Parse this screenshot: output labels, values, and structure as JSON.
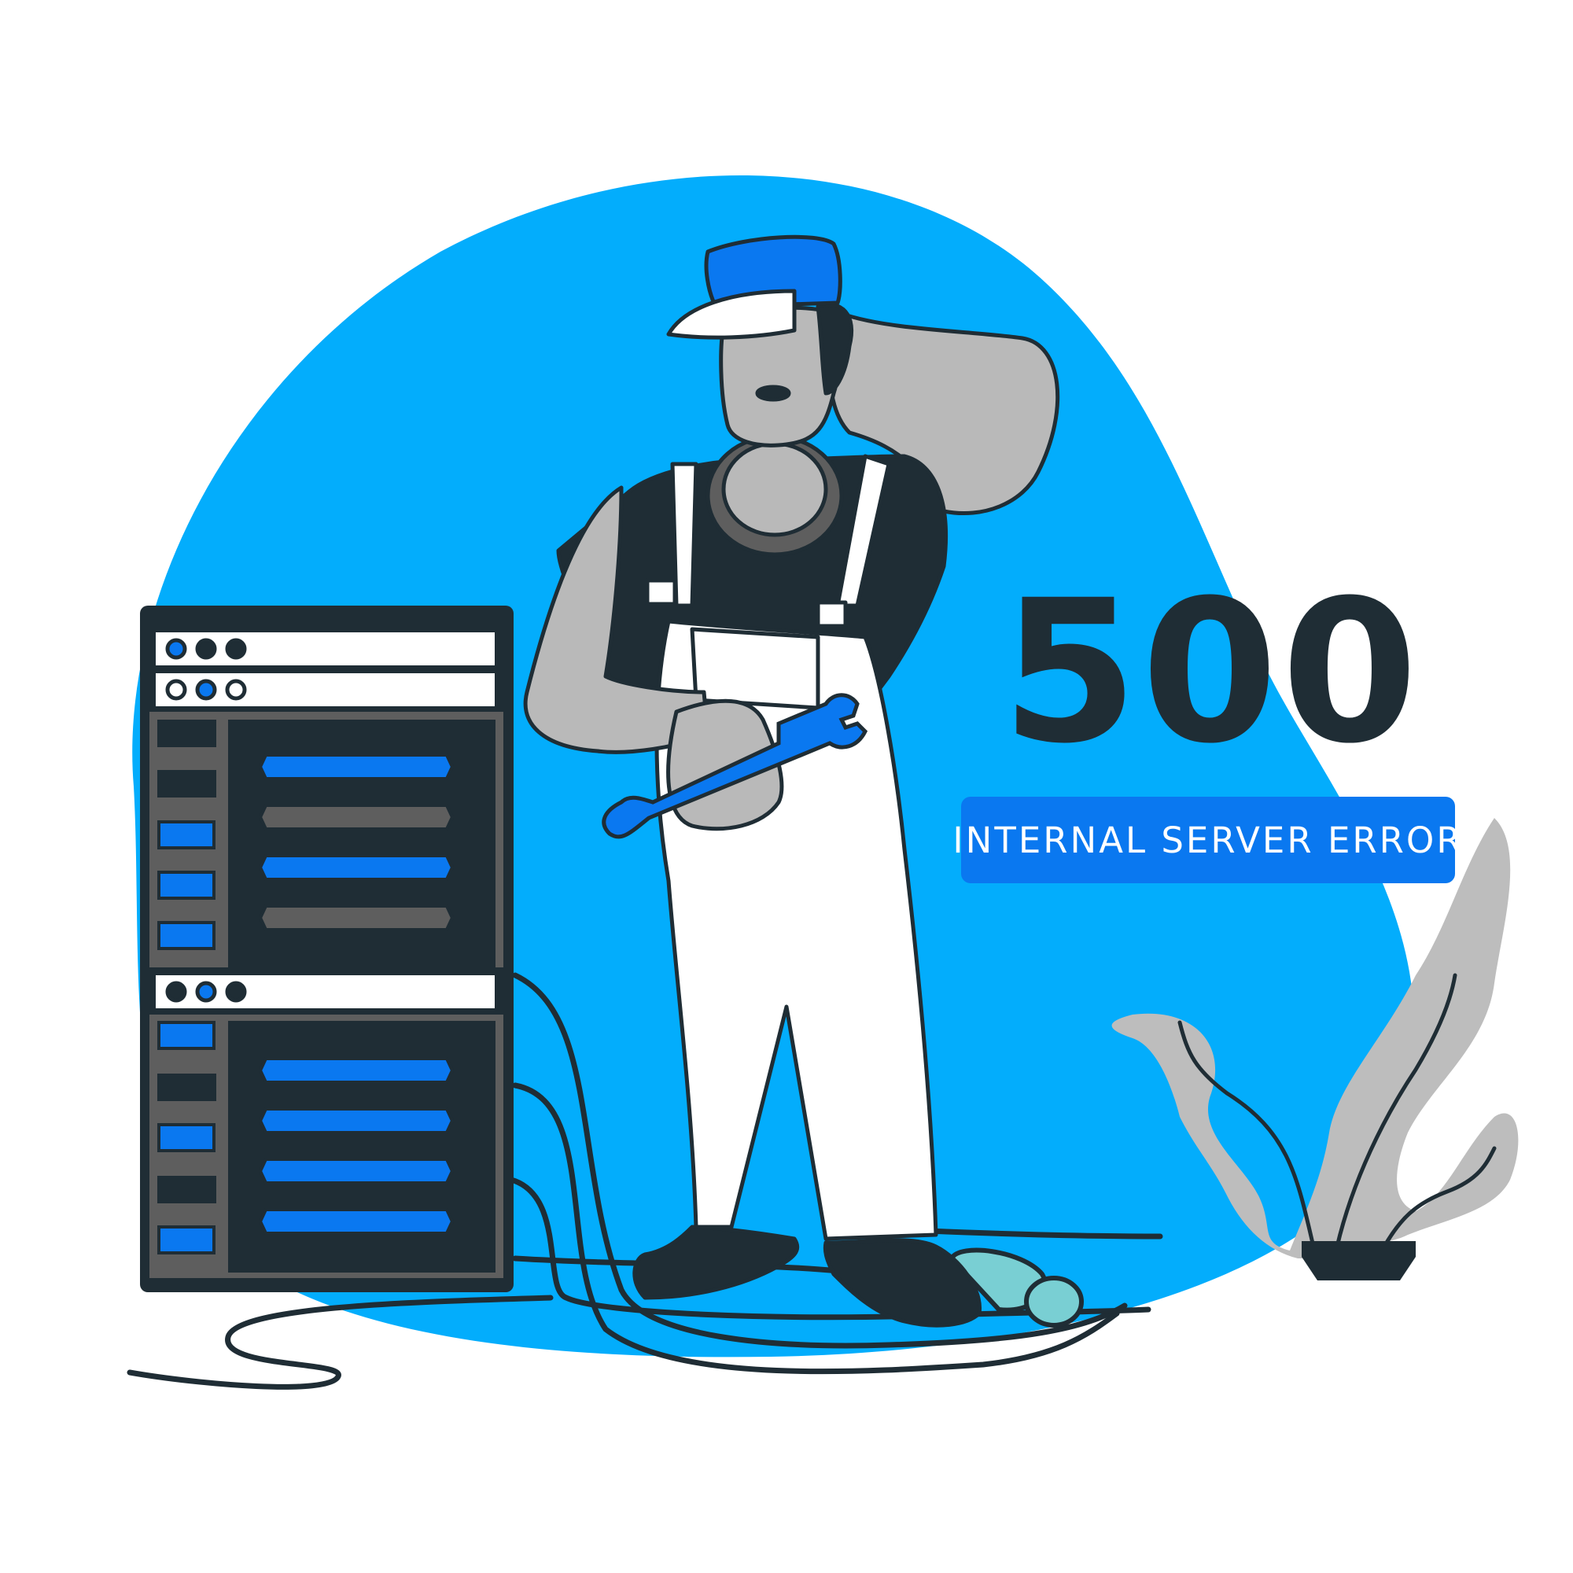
{
  "error": {
    "code": "500",
    "message": "INTERNAL SERVER ERROR"
  },
  "colors": {
    "blob": "#03adfc",
    "accent_blue": "#0a78f0",
    "dark": "#1f2d35",
    "skin": "#b9b9b9",
    "overall": "#ffffff",
    "smoke": "#bdbdbd",
    "plug": "#79cfd3"
  },
  "illustration": {
    "subject": "worker-with-wrench",
    "objects": [
      "server-rack",
      "cables",
      "smoking-plant",
      "electric-plug"
    ]
  }
}
